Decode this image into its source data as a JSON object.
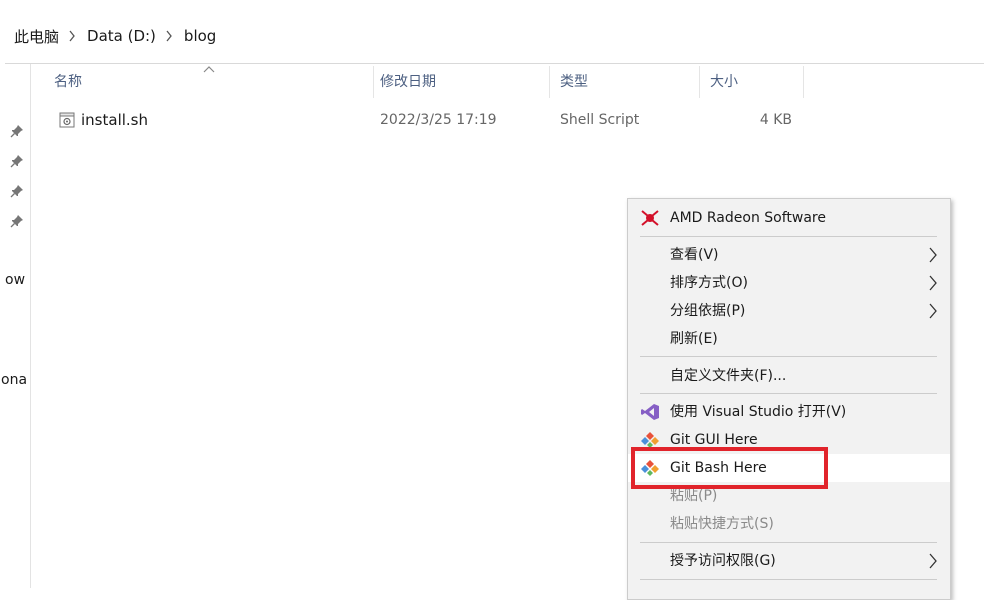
{
  "breadcrumb": {
    "items": [
      "此电脑",
      "Data (D:)",
      "blog"
    ]
  },
  "nav": {
    "partial_labels": [
      "ow",
      "ona"
    ]
  },
  "columns": {
    "name": "名称",
    "date": "修改日期",
    "type": "类型",
    "size": "大小"
  },
  "files": [
    {
      "name": "install.sh",
      "date": "2022/3/25 17:19",
      "type": "Shell Script",
      "size": "4 KB"
    }
  ],
  "context_menu": {
    "items": [
      {
        "label": "AMD Radeon Software",
        "icon": "amd-radeon-icon"
      },
      {
        "label": "查看(V)",
        "submenu": true
      },
      {
        "label": "排序方式(O)",
        "submenu": true
      },
      {
        "label": "分组依据(P)",
        "submenu": true
      },
      {
        "label": "刷新(E)"
      },
      {
        "label": "自定义文件夹(F)..."
      },
      {
        "label": "使用 Visual Studio 打开(V)",
        "icon": "visual-studio-icon"
      },
      {
        "label": "Git GUI Here",
        "icon": "git-gui-icon"
      },
      {
        "label": "Git Bash Here",
        "icon": "git-bash-icon",
        "highlighted": true
      },
      {
        "label": "粘贴(P)",
        "disabled": true
      },
      {
        "label": "粘贴快捷方式(S)",
        "disabled": true
      },
      {
        "label": "授予访问权限(G)",
        "submenu": true
      }
    ]
  },
  "colors": {
    "highlight_border": "#e1242b",
    "header_text": "#4d6082",
    "menu_bg": "#f2f2f2"
  }
}
